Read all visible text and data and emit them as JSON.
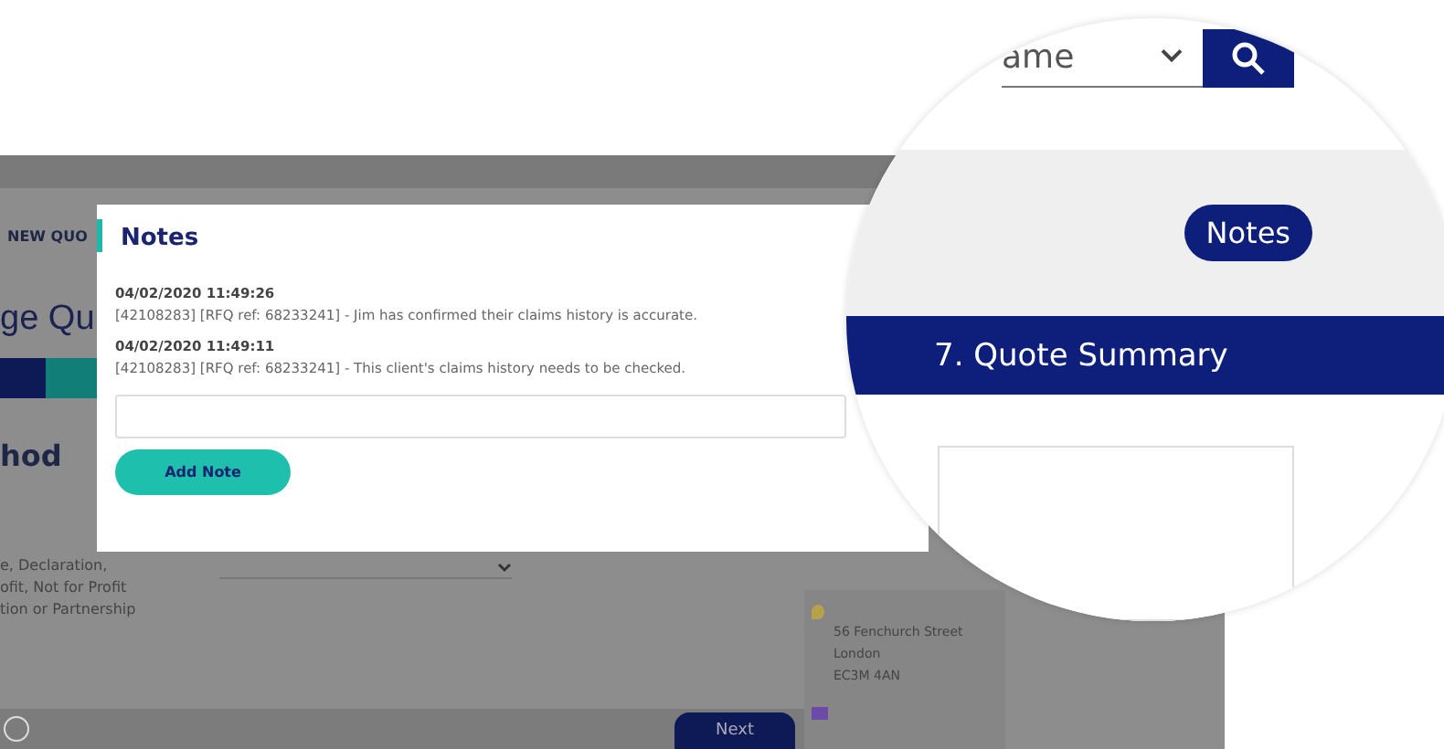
{
  "background": {
    "nav_tab": "NEW QUO",
    "heading": "ge Qu",
    "progress": {
      "level": 0.47
    },
    "radio": {
      "checked": false
    },
    "section": "hod",
    "description": [
      "e, Declaration,",
      "ofit, Not for Profit",
      "tion or Partnership"
    ],
    "address": [
      "56 Fenchurch Street",
      "London",
      "EC3M 4AN"
    ],
    "next_button": "Next"
  },
  "notes_dialog": {
    "title": "Notes",
    "notes": [
      {
        "timestamp": "04/02/2020 11:49:26",
        "text": "[42108283] [RFQ ref: 68233241] - Jim has confirmed their claims history is accurate."
      },
      {
        "timestamp": "04/02/2020 11:49:11",
        "text": "[42108283] [RFQ ref: 68233241] - This client's claims history needs to be checked."
      }
    ],
    "add_button": "Add Note"
  },
  "magnifier": {
    "search": {
      "value": "ame"
    },
    "notes_button": "Notes",
    "step": "7. Quote Summary"
  }
}
